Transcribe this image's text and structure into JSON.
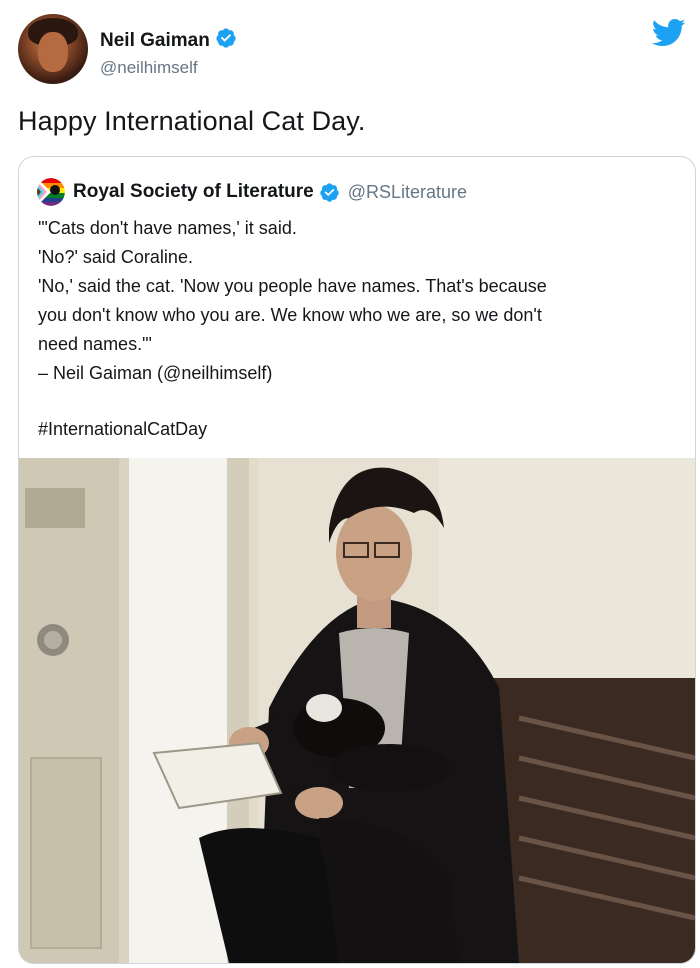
{
  "tweet": {
    "author_name": "Neil Gaiman",
    "author_handle": "@neilhimself",
    "text": "Happy International Cat Day."
  },
  "quoted_tweet": {
    "author_name": "Royal Society of Literature",
    "author_handle": "@RSLiterature",
    "lines": [
      "'\"Cats don't have names,' it said.",
      "'No?' said Coraline.",
      "'No,' said the cat. 'Now you people have names. That's because",
      "you don't know who you are. We know who we are, so we don't",
      "need names.\"'",
      "– Neil Gaiman (@neilhimself)"
    ],
    "hashtag": "#InternationalCatDay",
    "image_description_icon": "photo"
  },
  "colors": {
    "twitter_blue": "#1da1f2",
    "text": "#14171a",
    "secondary": "#657786",
    "border": "#ccd6dd"
  },
  "icons": {
    "verified": "verified-badge-icon",
    "bird": "twitter-bird-icon"
  }
}
